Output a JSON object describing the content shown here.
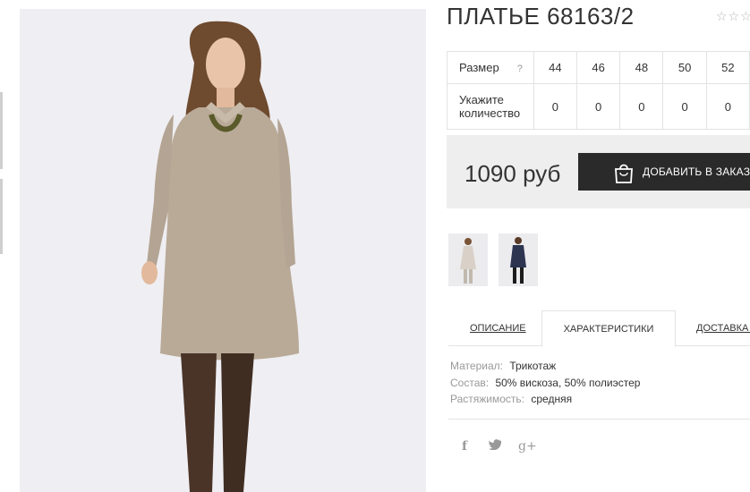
{
  "product": {
    "title": "ПЛАТЬЕ 68163/2",
    "rating_stars": "☆☆☆"
  },
  "sizes": {
    "size_label": "Размер",
    "help_icon": "?",
    "qty_label": "Укажите количество",
    "items": [
      {
        "size": "44",
        "qty": "0"
      },
      {
        "size": "46",
        "qty": "0"
      },
      {
        "size": "48",
        "qty": "0"
      },
      {
        "size": "50",
        "qty": "0"
      },
      {
        "size": "52",
        "qty": "0"
      }
    ]
  },
  "purchase": {
    "price": "1090 руб",
    "add_button_label": "ДОБАВИТЬ В ЗАКАЗ",
    "button_icon": "shopping-bag-icon"
  },
  "tabs": [
    {
      "label": "ОПИСАНИЕ",
      "active": false
    },
    {
      "label": "ХАРАКТЕРИСТИКИ",
      "active": true
    },
    {
      "label": "ДОСТАВКА И",
      "active": false
    }
  ],
  "specs": [
    {
      "key": "Материал:",
      "value": "Трикотаж"
    },
    {
      "key": "Состав:",
      "value": "50% вискоза, 50% полиэстер"
    },
    {
      "key": "Растяжимость:",
      "value": "средняя"
    }
  ],
  "social": {
    "facebook": "f",
    "twitter": "🐦",
    "gplus": "g+"
  },
  "colors": {
    "button_bg": "#2a2a2a",
    "price_box_bg": "#eeeeee",
    "border": "#e3e3e3",
    "photo_bg": "#efeef2",
    "dress_beige": "#b9aa98",
    "dress_navy": "#2c3450"
  }
}
